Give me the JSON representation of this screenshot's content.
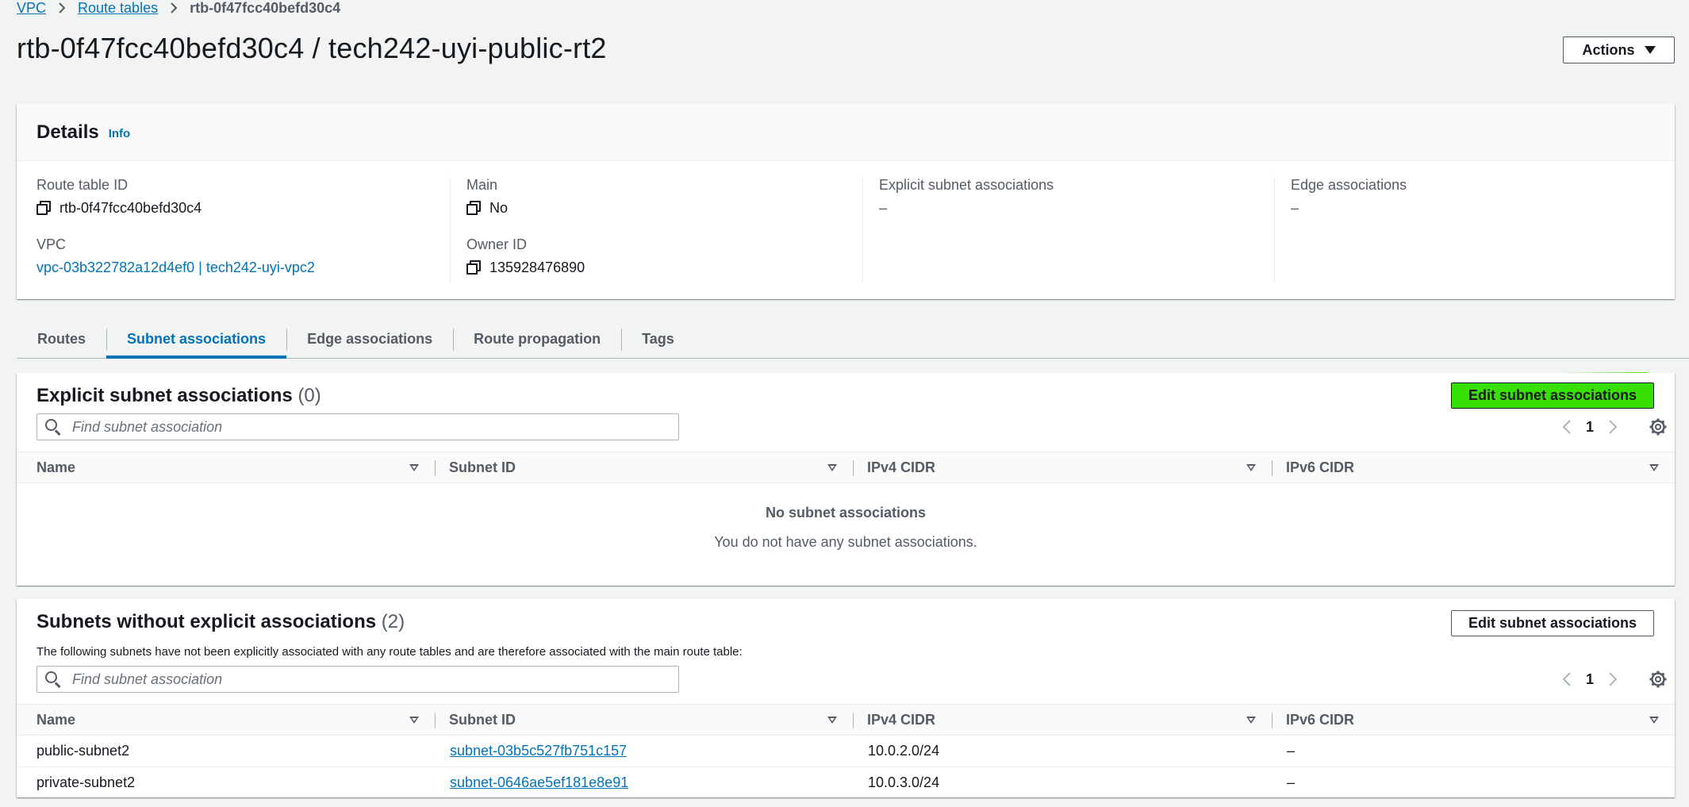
{
  "breadcrumb": {
    "items": [
      "VPC",
      "Route tables"
    ],
    "current": "rtb-0f47fcc40befd30c4"
  },
  "page": {
    "title": "rtb-0f47fcc40befd30c4 / tech242-uyi-public-rt2",
    "actions_label": "Actions"
  },
  "details": {
    "title": "Details",
    "info_label": "Info",
    "route_table_id_label": "Route table ID",
    "route_table_id": "rtb-0f47fcc40befd30c4",
    "vpc_label": "VPC",
    "vpc_value": "vpc-03b322782a12d4ef0 | tech242-uyi-vpc2",
    "main_label": "Main",
    "main_value": "No",
    "owner_label": "Owner ID",
    "owner_value": "135928476890",
    "explicit_label": "Explicit subnet associations",
    "explicit_value": "–",
    "edge_label": "Edge associations",
    "edge_value": "–"
  },
  "tabs": [
    "Routes",
    "Subnet associations",
    "Edge associations",
    "Route propagation",
    "Tags"
  ],
  "active_tab": "Subnet associations",
  "explicit": {
    "title": "Explicit subnet associations",
    "count": "(0)",
    "edit_label": "Edit subnet associations",
    "search_placeholder": "Find subnet association",
    "page": "1",
    "columns": [
      "Name",
      "Subnet ID",
      "IPv4 CIDR",
      "IPv6 CIDR"
    ],
    "empty_title": "No subnet associations",
    "empty_desc": "You do not have any subnet associations."
  },
  "implicit": {
    "title": "Subnets without explicit associations",
    "count": "(2)",
    "description": "The following subnets have not been explicitly associated with any route tables and are therefore associated with the main route table:",
    "edit_label": "Edit subnet associations",
    "search_placeholder": "Find subnet association",
    "page": "1",
    "columns": [
      "Name",
      "Subnet ID",
      "IPv4 CIDR",
      "IPv6 CIDR"
    ],
    "rows": [
      {
        "name": "public-subnet2",
        "subnet_id": "subnet-03b5c527fb751c157",
        "ipv4": "10.0.2.0/24",
        "ipv6": "–"
      },
      {
        "name": "private-subnet2",
        "subnet_id": "subnet-0646ae5ef181e8e91",
        "ipv4": "10.0.3.0/24",
        "ipv6": "–"
      }
    ]
  },
  "colors": {
    "link": "#0073bb",
    "highlight": "#3ee000",
    "background": "#f2f3f3"
  }
}
